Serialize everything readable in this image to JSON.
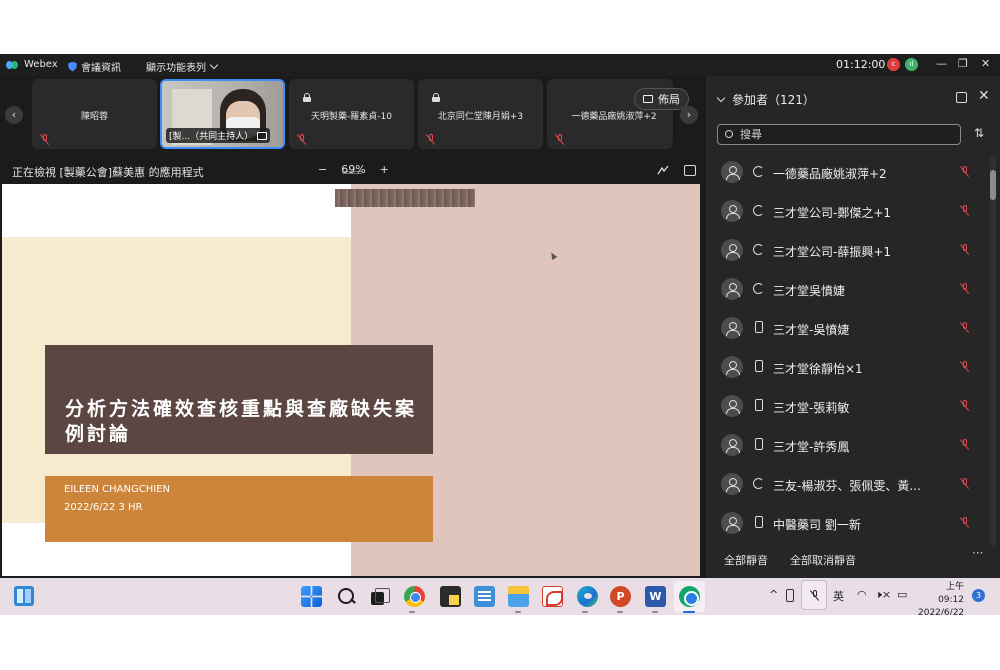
{
  "titlebar": {
    "app_name": "Webex",
    "meeting_info": "會議資訊",
    "view_menu": "顯示功能表列",
    "timer": "01:12:00",
    "rec_badge": "c",
    "tool_badge": "ıl",
    "minimize": "—",
    "restore": "❐",
    "close": "✕"
  },
  "video_strip": {
    "prev": "‹",
    "next": "›",
    "tiles": [
      {
        "name": "陳昭蓉",
        "locked": false
      },
      {
        "name": "[製...（共同主持人）",
        "locked": false,
        "video": true
      },
      {
        "name": "天明製藥-羅素貞-10",
        "locked": true
      },
      {
        "name": "北京同仁堂陳月娟+3",
        "locked": true
      },
      {
        "name": "一德藥品廠姚淑萍+2",
        "locked": false
      }
    ],
    "layout_button": "佈局"
  },
  "view_bar": {
    "viewing_text": "正在檢視 [製藥公會]蘇美惠 的應用程式",
    "zoom_out": "−",
    "zoom_value": "69%",
    "zoom_in": "+"
  },
  "slide": {
    "title": "分析方法確效查核重點與查廠缺失案例討論",
    "author": "EILEEN CHANGCHIEN",
    "date_line": "2022/6/22   3 HR"
  },
  "participants": {
    "title": "參加者（121）",
    "search_placeholder": "搜尋",
    "sort_icon": "⇅",
    "close": "✕",
    "list": [
      {
        "name": "一德藥品廠姚淑萍+2",
        "device": "sync"
      },
      {
        "name": "三才堂公司-鄭傑之+1",
        "device": "sync"
      },
      {
        "name": "三才堂公司-薛振興+1",
        "device": "sync"
      },
      {
        "name": "三才堂吳憤婕",
        "device": "sync"
      },
      {
        "name": "三才堂-吳憤婕",
        "device": "phone"
      },
      {
        "name": "三才堂徐靜怡×1",
        "device": "phone"
      },
      {
        "name": "三才堂-張莉敏",
        "device": "phone"
      },
      {
        "name": "三才堂-許秀鳳",
        "device": "phone"
      },
      {
        "name": "三友-楊淑芬、張佩雯、黃...",
        "device": "sync"
      },
      {
        "name": "中醫藥司 劉一新",
        "device": "phone"
      }
    ],
    "mute_all": "全部靜音",
    "unmute_all": "全部取消靜音",
    "more": "···"
  },
  "taskbar": {
    "ppt_letter": "P",
    "word_letter": "W",
    "tray_chevron": "^",
    "ime": "英",
    "wifi": "◠",
    "volume": "🕨×",
    "battery": "▭",
    "time": "上午 09:12",
    "date": "2022/6/22",
    "notifications": "3"
  }
}
